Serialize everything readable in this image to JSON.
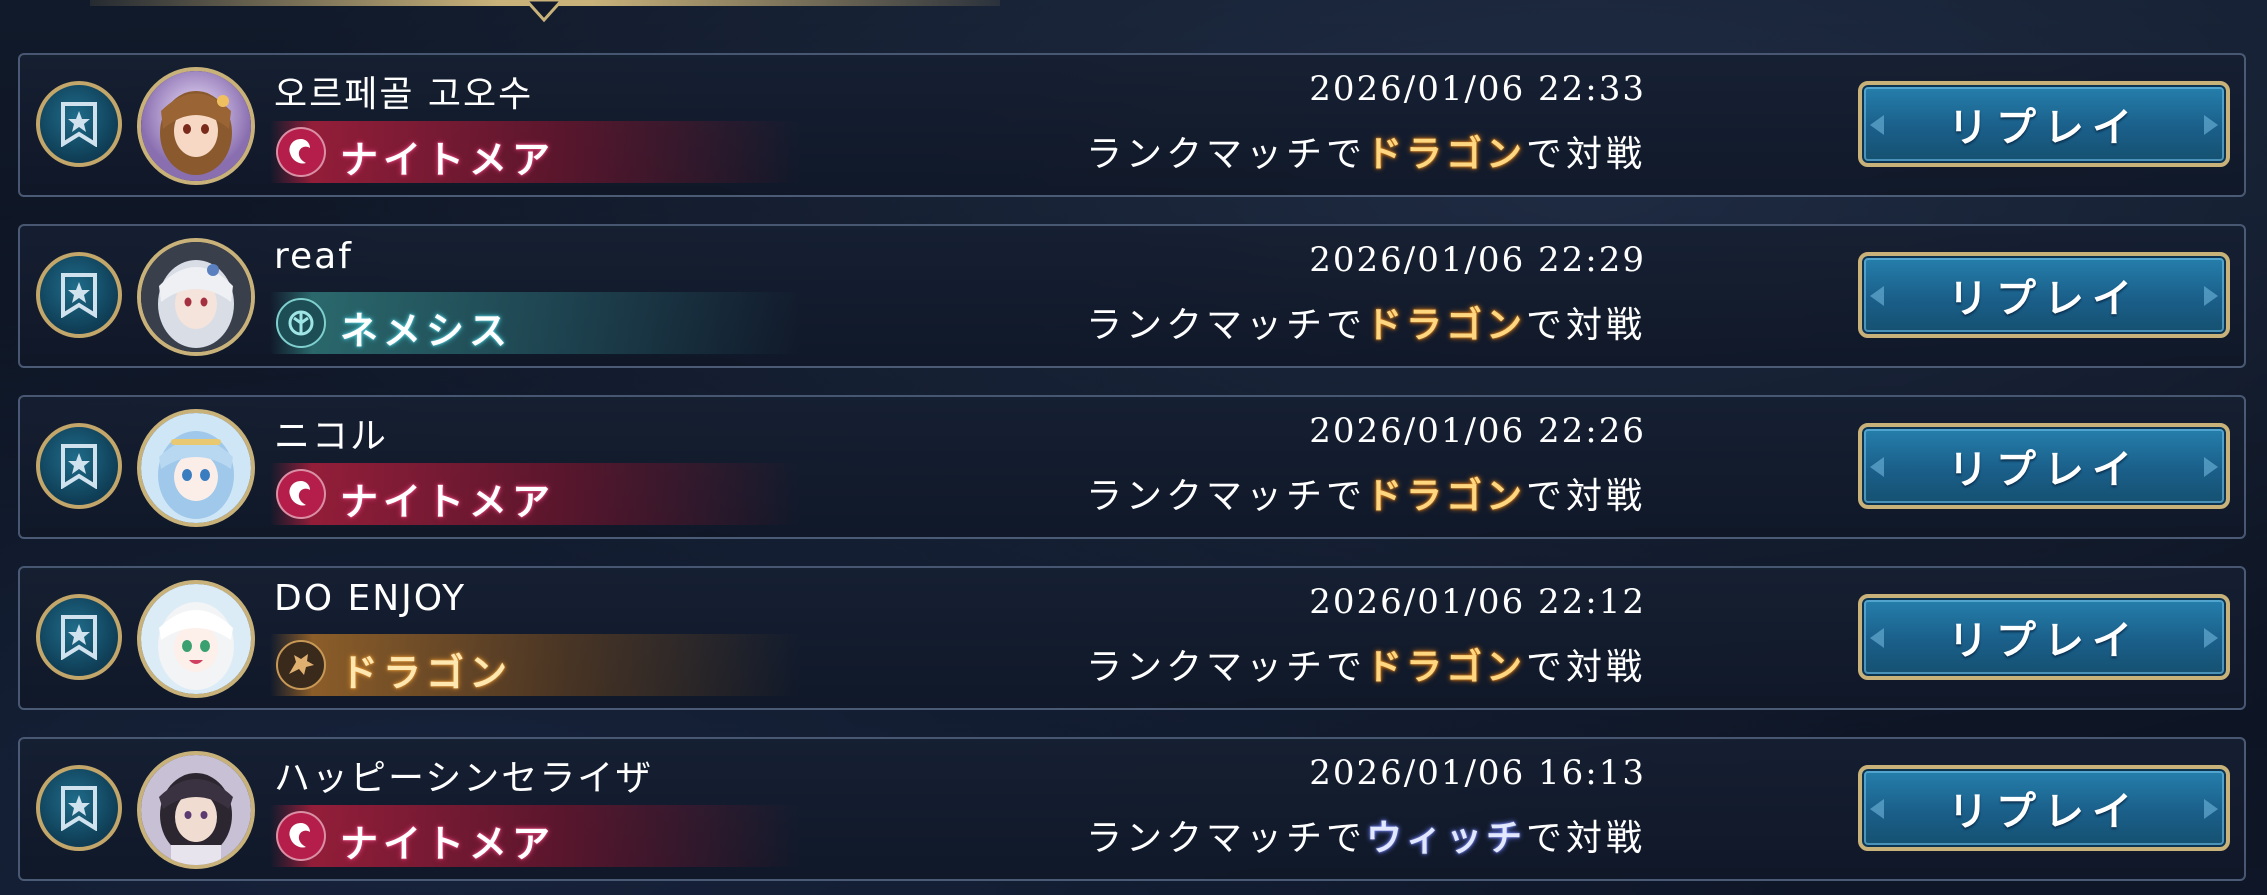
{
  "colors": {
    "gold_border": "#c9b27a",
    "replay_button": "#1f6c96",
    "nightmare": "#b51e4a",
    "nemesis": "#2f8a8a",
    "dragon": "#c88a30",
    "witch_text": "#8a98ff"
  },
  "replay_list": [
    {
      "player_name": "오르페골 고오수",
      "player_class": "ナイトメア",
      "player_class_key": "nightmare",
      "avatar": "female-character-avatar",
      "timestamp": "2026/01/06 22:33",
      "desc_prefix": "ランクマッチで",
      "opponent_class": "ドラゴン",
      "desc_suffix": "で対戦",
      "replay_label": "リプレイ"
    },
    {
      "player_name": "reaf",
      "player_class": "ネメシス",
      "player_class_key": "nemesis",
      "avatar": "silver-hair-character-avatar",
      "timestamp": "2026/01/06 22:29",
      "desc_prefix": "ランクマッチで",
      "opponent_class": "ドラゴン",
      "desc_suffix": "で対戦",
      "replay_label": "リプレイ"
    },
    {
      "player_name": "ニコル",
      "player_class": "ナイトメア",
      "player_class_key": "nightmare",
      "avatar": "blue-hair-character-avatar",
      "timestamp": "2026/01/06 22:26",
      "desc_prefix": "ランクマッチで",
      "opponent_class": "ドラゴン",
      "desc_suffix": "で対戦",
      "replay_label": "リプレイ"
    },
    {
      "player_name": "DO ENJOY",
      "player_class": "ドラゴン",
      "player_class_key": "dragon",
      "avatar": "white-hair-character-avatar",
      "timestamp": "2026/01/06 22:12",
      "desc_prefix": "ランクマッチで",
      "opponent_class": "ドラゴン",
      "desc_suffix": "で対戦",
      "replay_label": "リプレイ"
    },
    {
      "player_name": "ハッピーシンセライザ",
      "player_class": "ナイトメア",
      "player_class_key": "nightmare",
      "avatar": "dark-hair-character-avatar",
      "timestamp": "2026/01/06 16:13",
      "desc_prefix": "ランクマッチで",
      "opponent_class": "ウィッチ",
      "desc_suffix": "で対戦",
      "replay_label": "リプレイ"
    }
  ]
}
